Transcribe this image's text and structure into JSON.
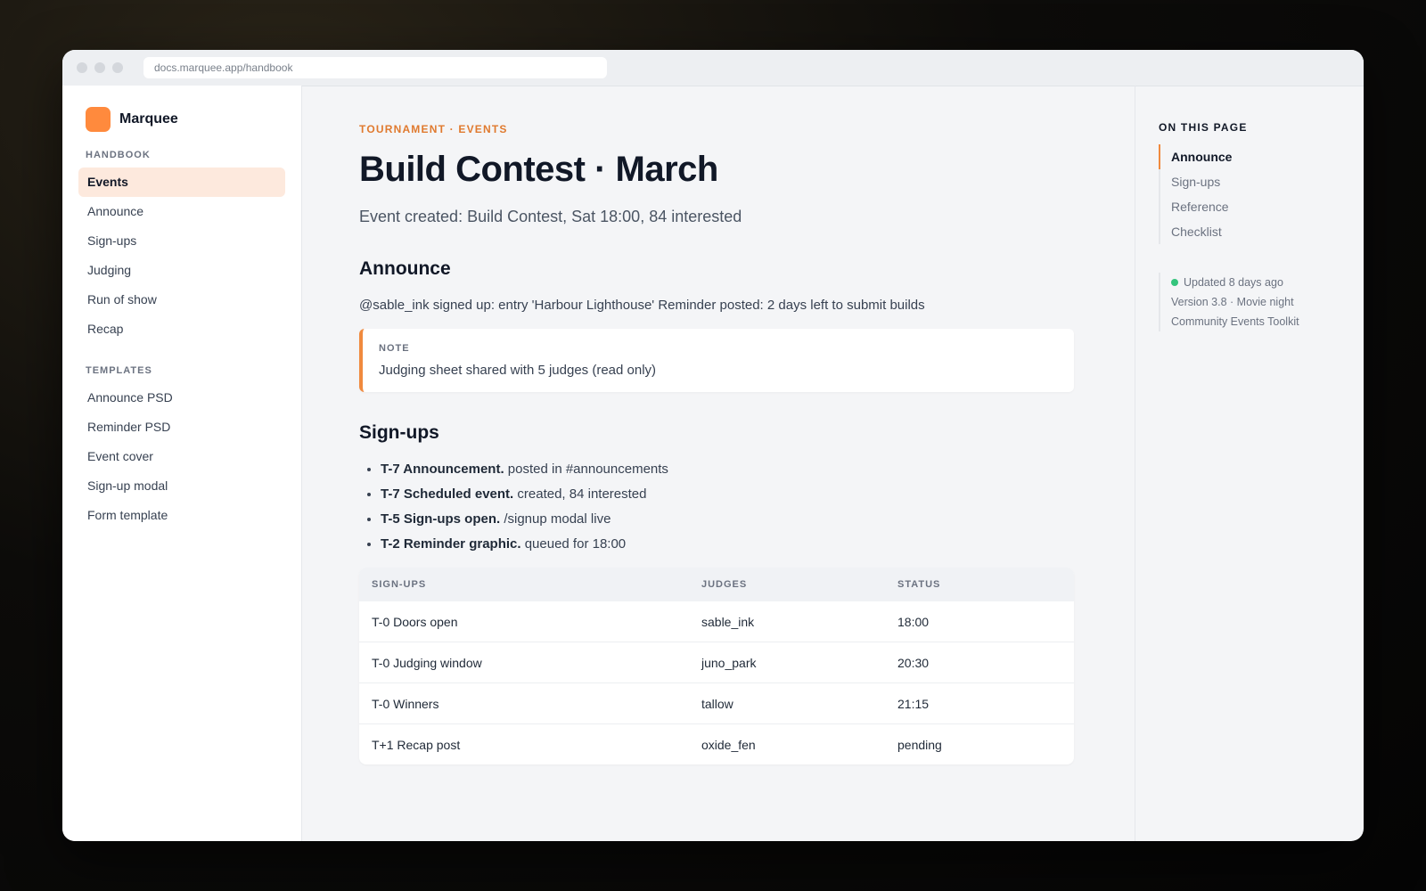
{
  "browser": {
    "url": "docs.marquee.app/handbook"
  },
  "brand": {
    "name": "Marquee",
    "logo_color": "#ff8a3d"
  },
  "sidebar": {
    "handbook_label": "HANDBOOK",
    "handbook_items": [
      {
        "label": "Events",
        "active": true
      },
      {
        "label": "Announce"
      },
      {
        "label": "Sign-ups"
      },
      {
        "label": "Judging"
      },
      {
        "label": "Run of show"
      },
      {
        "label": "Recap"
      }
    ],
    "templates_label": "TEMPLATES",
    "template_items": [
      {
        "label": "Announce PSD"
      },
      {
        "label": "Reminder PSD"
      },
      {
        "label": "Event cover"
      },
      {
        "label": "Sign-up modal"
      },
      {
        "label": "Form template"
      }
    ]
  },
  "main": {
    "eyebrow": "Tournament · Events",
    "title": "Build Contest · March",
    "subtitle": "Event created: Build Contest, Sat 18:00, 84 interested",
    "announce": {
      "heading": "Announce",
      "paragraph": "@sable_ink signed up: entry 'Harbour Lighthouse' Reminder posted: 2 days left to submit builds",
      "note_label": "NOTE",
      "note_text": "Judging sheet shared with 5 judges (read only)"
    },
    "signups": {
      "heading": "Sign-ups",
      "steps": [
        {
          "bold": "T-7 Announcement.",
          "text": " posted in #announcements"
        },
        {
          "bold": "T-7 Scheduled event.",
          "text": " created, 84 interested"
        },
        {
          "bold": "T-5 Sign-ups open.",
          "text": " /signup modal live"
        },
        {
          "bold": "T-2 Reminder graphic.",
          "text": " queued for 18:00"
        }
      ],
      "table": {
        "headers": [
          "SIGN-UPS",
          "JUDGES",
          "STATUS"
        ],
        "rows": [
          [
            "T-0 Doors open",
            "sable_ink",
            "18:00"
          ],
          [
            "T-0 Judging window",
            "juno_park",
            "20:30"
          ],
          [
            "T-0 Winners",
            "tallow",
            "21:15"
          ],
          [
            "T+1 Recap post",
            "oxide_fen",
            "pending"
          ]
        ]
      }
    }
  },
  "toc": {
    "title": "ON THIS PAGE",
    "items": [
      {
        "label": "Announce",
        "active": true
      },
      {
        "label": "Sign-ups"
      },
      {
        "label": "Reference"
      },
      {
        "label": "Checklist"
      }
    ],
    "meta": {
      "updated": "Updated 8 days ago",
      "version": "Version 3.8 · Movie night",
      "toolkit": "Community Events Toolkit"
    }
  },
  "colors": {
    "accent": "#f08a3e",
    "status_ok": "#34c47c"
  }
}
